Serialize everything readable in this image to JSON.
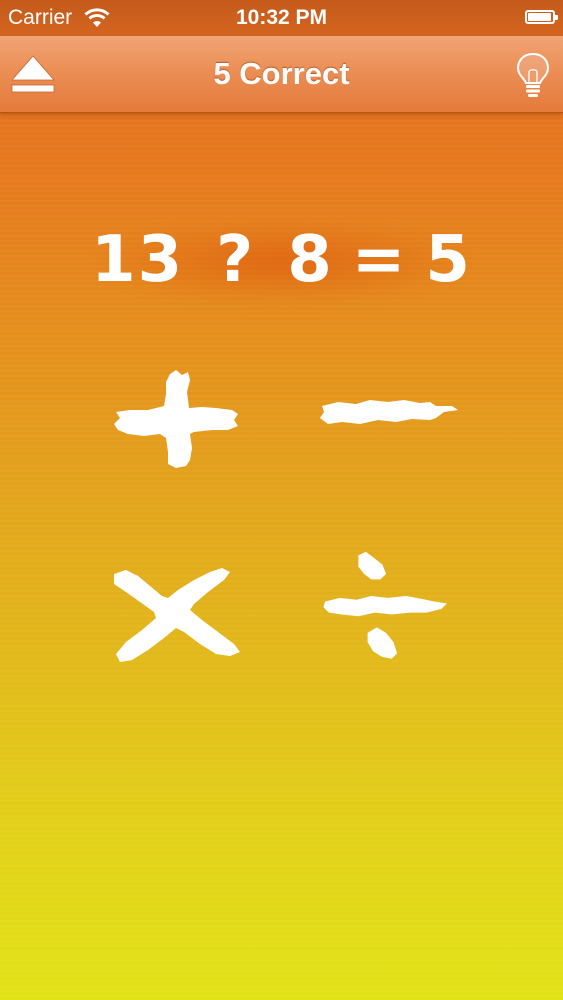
{
  "status_bar": {
    "carrier": "Carrier",
    "time": "10:32 PM",
    "battery_level": 0.95
  },
  "nav": {
    "title": "5 Correct",
    "left_icon": "eject-icon",
    "right_icon": "lightbulb-icon"
  },
  "equation": {
    "left": "13",
    "operator": "?",
    "right": "8",
    "equals": "=",
    "result": "5"
  },
  "operators": [
    {
      "symbol": "+",
      "icon": "plus-icon"
    },
    {
      "symbol": "−",
      "icon": "minus-icon"
    },
    {
      "symbol": "×",
      "icon": "multiply-icon"
    },
    {
      "symbol": "÷",
      "icon": "divide-icon"
    }
  ],
  "colors": {
    "background_top": "#e36a1f",
    "background_bottom": "#e2e317",
    "nav_bar": "#eb8f56",
    "glyph": "#ffffff"
  }
}
